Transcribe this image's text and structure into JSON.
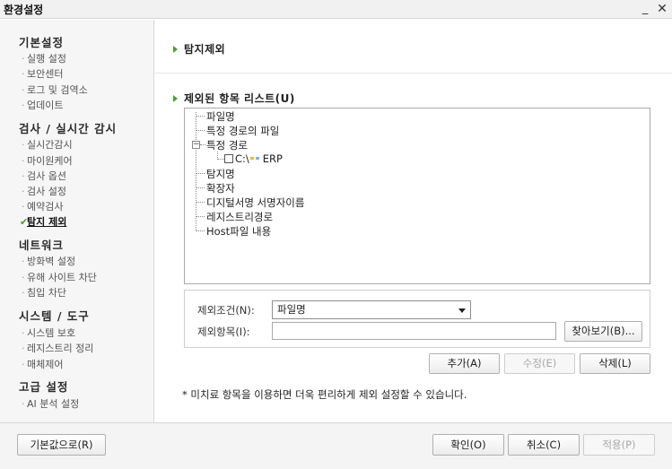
{
  "window": {
    "title": "환경설정",
    "minimize": "_",
    "close": "✕"
  },
  "sidebar": {
    "groups": [
      {
        "label": "기본설정",
        "items": [
          "실행 설정",
          "보안센터",
          "로그 및 검역소",
          "업데이트"
        ]
      },
      {
        "label": "검사 / 실시간 감시",
        "items": [
          "실시간감시",
          "마이원케어",
          "검사 옵션",
          "검사 설정",
          "예약검사",
          "탐지 제외"
        ]
      },
      {
        "label": "네트워크",
        "items": [
          "방화벽 설정",
          "유해 사이트 차단",
          "침입 차단"
        ]
      },
      {
        "label": "시스템 / 도구",
        "items": [
          "시스템 보호",
          "레지스트리 정리",
          "매체제어"
        ]
      },
      {
        "label": "고급 설정",
        "items": [
          "AI 분석 설정"
        ]
      }
    ],
    "active_item": "탐지 제외"
  },
  "main": {
    "title": "탐지제외",
    "list_title": "제외된 항목 리스트(U)",
    "tree": [
      "파일명",
      "특정 경로의 파일",
      "특정 경로",
      "C:\\",
      "ERP",
      "탐지명",
      "확장자",
      "디지털서명 서명자이름",
      "레지스트리경로",
      "Host파일 내용"
    ],
    "condition_label": "제외조건(N):",
    "condition_value": "파일명",
    "item_label": "제외항목(I):",
    "item_value": "",
    "browse_button": "찾아보기(B)...",
    "add_button": "추가(A)",
    "edit_button": "수정(E)",
    "delete_button": "삭제(L)",
    "note": "*  미치료 항목을 이용하면 더욱 편리하게 제외 설정할 수 있습니다."
  },
  "footer": {
    "default_button": "기본값으로(R)",
    "ok_button": "확인(O)",
    "cancel_button": "취소(C)",
    "apply_button": "적용(P)"
  },
  "colors": {
    "accent_green": "#4aa02c",
    "mask_orange": "#f0b33a",
    "mask_blue": "#6fb8e8"
  }
}
